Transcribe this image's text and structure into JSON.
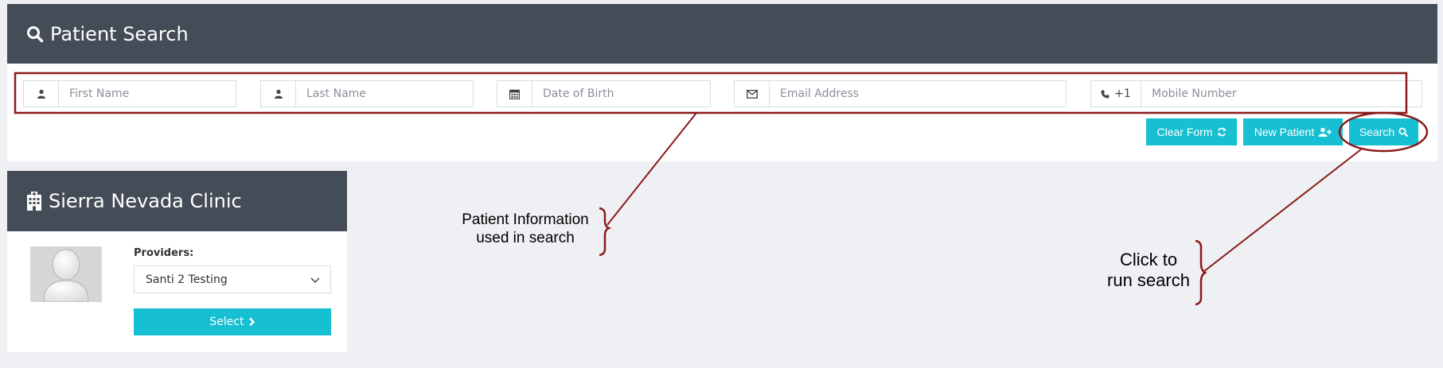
{
  "search": {
    "title": "Patient Search",
    "first_name_placeholder": "First Name",
    "last_name_placeholder": "Last Name",
    "dob_placeholder": "Date of Birth",
    "email_placeholder": "Email Address",
    "phone_prefix": "+1",
    "mobile_placeholder": "Mobile Number",
    "clear_label": "Clear Form",
    "new_patient_label": "New Patient",
    "search_label": "Search"
  },
  "clinic": {
    "title": "Sierra Nevada Clinic",
    "providers_label": "Providers:",
    "selected_provider": "Santi 2 Testing",
    "select_label": "Select"
  },
  "annotations": {
    "patient_info_line1": "Patient Information",
    "patient_info_line2": "used in search",
    "click_line1": "Click to",
    "click_line2": "run search"
  },
  "colors": {
    "header_bg": "#444c58",
    "accent": "#17bfd2",
    "annotation": "#8b1a1a",
    "page_bg": "#eff0f4"
  },
  "icons": [
    "search-icon",
    "user-icon",
    "calendar-icon",
    "envelope-icon",
    "phone-icon",
    "refresh-icon",
    "user-plus-icon",
    "hospital-icon",
    "chevron-down-icon",
    "chevron-right-icon",
    "avatar-silhouette"
  ]
}
